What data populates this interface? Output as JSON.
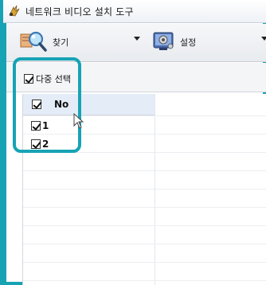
{
  "window": {
    "title": "네트워크 비디오 설치 도구"
  },
  "toolbar": {
    "find_label": "찾기",
    "settings_label": "설정"
  },
  "options": {
    "multi_select_label": "다중 선택",
    "multi_select_checked": true
  },
  "grid": {
    "header_label": "No",
    "rows": [
      {
        "label": "1",
        "checked": true
      },
      {
        "label": "2",
        "checked": true
      }
    ]
  },
  "colors": {
    "highlight": "#17a3b4",
    "header_bg": "#e4ecf7"
  }
}
